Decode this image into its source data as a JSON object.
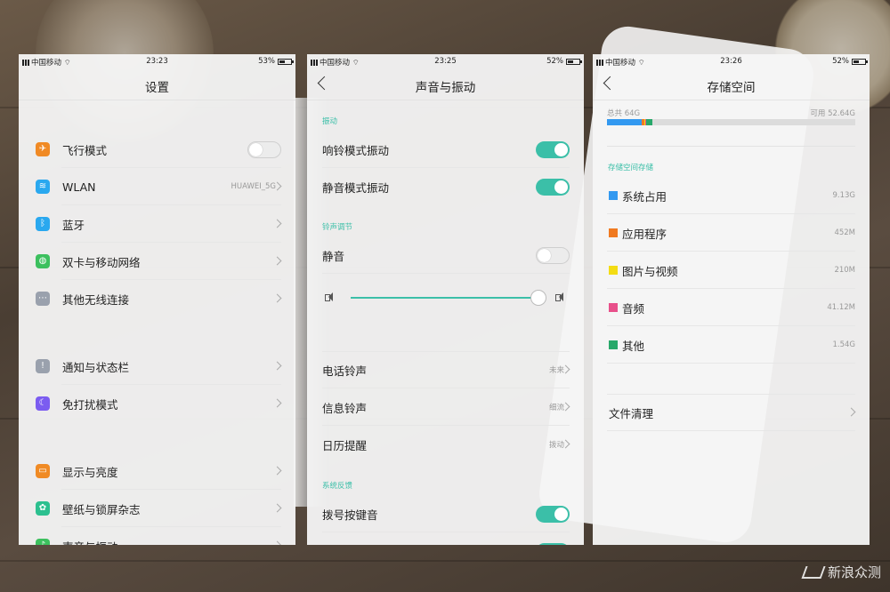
{
  "watermark": "新浪众测",
  "settings": {
    "status": {
      "carrier": "中国移动",
      "time": "23:23",
      "battery": "53%",
      "battery_pct": 53
    },
    "title": "设置",
    "items": [
      {
        "label": "飞行模式",
        "icon": "airplane-icon",
        "color": "#f08a24"
      },
      {
        "label": "WLAN",
        "value": "HUAWEI_5G",
        "icon": "wifi-icon",
        "color": "#2aa8ef"
      },
      {
        "label": "蓝牙",
        "icon": "bluetooth-icon",
        "color": "#2aa8ef"
      },
      {
        "label": "双卡与移动网络",
        "icon": "globe-icon",
        "color": "#3cc05e"
      },
      {
        "label": "其他无线连接",
        "icon": "more-icon",
        "color": "#9aa1ad"
      },
      {
        "label": "通知与状态栏",
        "icon": "exclamation-icon",
        "color": "#9aa1ad"
      },
      {
        "label": "免打扰模式",
        "icon": "moon-icon",
        "color": "#7b5cf0"
      },
      {
        "label": "显示与亮度",
        "icon": "display-icon",
        "color": "#f08a24"
      },
      {
        "label": "壁纸与锁屏杂志",
        "icon": "flower-icon",
        "color": "#2cc08f"
      },
      {
        "label": "声音与振动",
        "icon": "sound-icon",
        "color": "#3cc05e"
      }
    ]
  },
  "sound": {
    "status": {
      "carrier": "中国移动",
      "time": "23:25",
      "battery": "52%",
      "battery_pct": 52
    },
    "title": "声音与振动",
    "section_vibrate": "振动",
    "ring_vibrate": "响铃模式振动",
    "silent_vibrate": "静音模式振动",
    "section_ringtone": "铃声调节",
    "mute": "静音",
    "volume_level": 0.95,
    "phone_ringtone": "电话铃声",
    "phone_ringtone_value": "未来",
    "message_ringtone": "信息铃声",
    "message_ringtone_value": "细流",
    "calendar_reminder": "日历提醒",
    "calendar_reminder_value": "拨动",
    "section_feedback": "系统反馈",
    "dial_tone": "拨号按键音"
  },
  "storage": {
    "status": {
      "carrier": "中国移动",
      "time": "23:26",
      "battery": "52%",
      "battery_pct": 52
    },
    "title": "存储空间",
    "total": "总共 64G",
    "available": "可用 52.64G",
    "section": "存储空间存储",
    "items": [
      {
        "label": "系统占用",
        "value": "9.13G",
        "color": "#3399f0"
      },
      {
        "label": "应用程序",
        "value": "452M",
        "color": "#f07a20"
      },
      {
        "label": "图片与视频",
        "value": "210M",
        "color": "#f3dc14"
      },
      {
        "label": "音频",
        "value": "41.12M",
        "color": "#e8508a"
      },
      {
        "label": "其他",
        "value": "1.54G",
        "color": "#28a86a"
      }
    ],
    "file_clean": "文件清理"
  }
}
